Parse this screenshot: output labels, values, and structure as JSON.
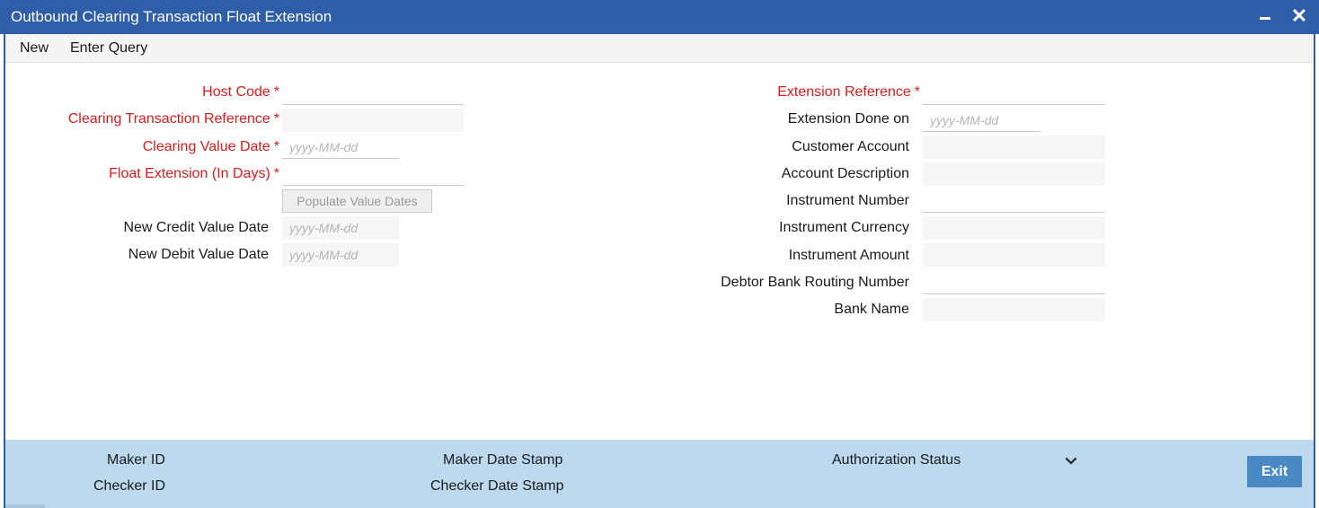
{
  "window": {
    "title": "Outbound Clearing Transaction Float Extension",
    "minimize_icon": "minimize-icon",
    "close_icon": "close-icon"
  },
  "menu": {
    "items": [
      "New",
      "Enter Query"
    ]
  },
  "left_form": {
    "host_code": {
      "label": "Host Code",
      "required": true,
      "value": ""
    },
    "clearing_transaction_reference": {
      "label": "Clearing Transaction Reference",
      "required": true,
      "value": ""
    },
    "clearing_value_date": {
      "label": "Clearing Value Date",
      "required": true,
      "placeholder": "yyyy-MM-dd"
    },
    "float_extension_days": {
      "label": "Float Extension (In Days)",
      "required": true,
      "value": ""
    },
    "populate_button": "Populate Value Dates",
    "new_credit_value_date": {
      "label": "New Credit Value Date",
      "placeholder": "yyyy-MM-dd"
    },
    "new_debit_value_date": {
      "label": "New Debit Value Date",
      "placeholder": "yyyy-MM-dd"
    }
  },
  "right_form": {
    "extension_reference": {
      "label": "Extension Reference",
      "required": true,
      "value": ""
    },
    "extension_done_on": {
      "label": "Extension Done on",
      "placeholder": "yyyy-MM-dd"
    },
    "customer_account": {
      "label": "Customer Account",
      "value": ""
    },
    "account_description": {
      "label": "Account Description",
      "value": ""
    },
    "instrument_number": {
      "label": "Instrument Number",
      "value": ""
    },
    "instrument_currency": {
      "label": "Instrument Currency",
      "value": ""
    },
    "instrument_amount": {
      "label": "Instrument Amount",
      "value": ""
    },
    "debtor_bank_routing_number": {
      "label": "Debtor Bank Routing Number",
      "value": ""
    },
    "bank_name": {
      "label": "Bank Name",
      "value": ""
    }
  },
  "required_marker": "*",
  "footer": {
    "maker_id": "Maker ID",
    "checker_id": "Checker ID",
    "maker_date_stamp": "Maker Date Stamp",
    "checker_date_stamp": "Checker Date Stamp",
    "authorization_status": "Authorization Status",
    "dropdown_icon": "chevron-down-icon",
    "exit_button": "Exit"
  },
  "colors": {
    "titlebar": "#2f5ea8",
    "required_label": "#e0191b",
    "footer_bg": "#bdd9ee",
    "exit_button": "#4a8ac4"
  }
}
